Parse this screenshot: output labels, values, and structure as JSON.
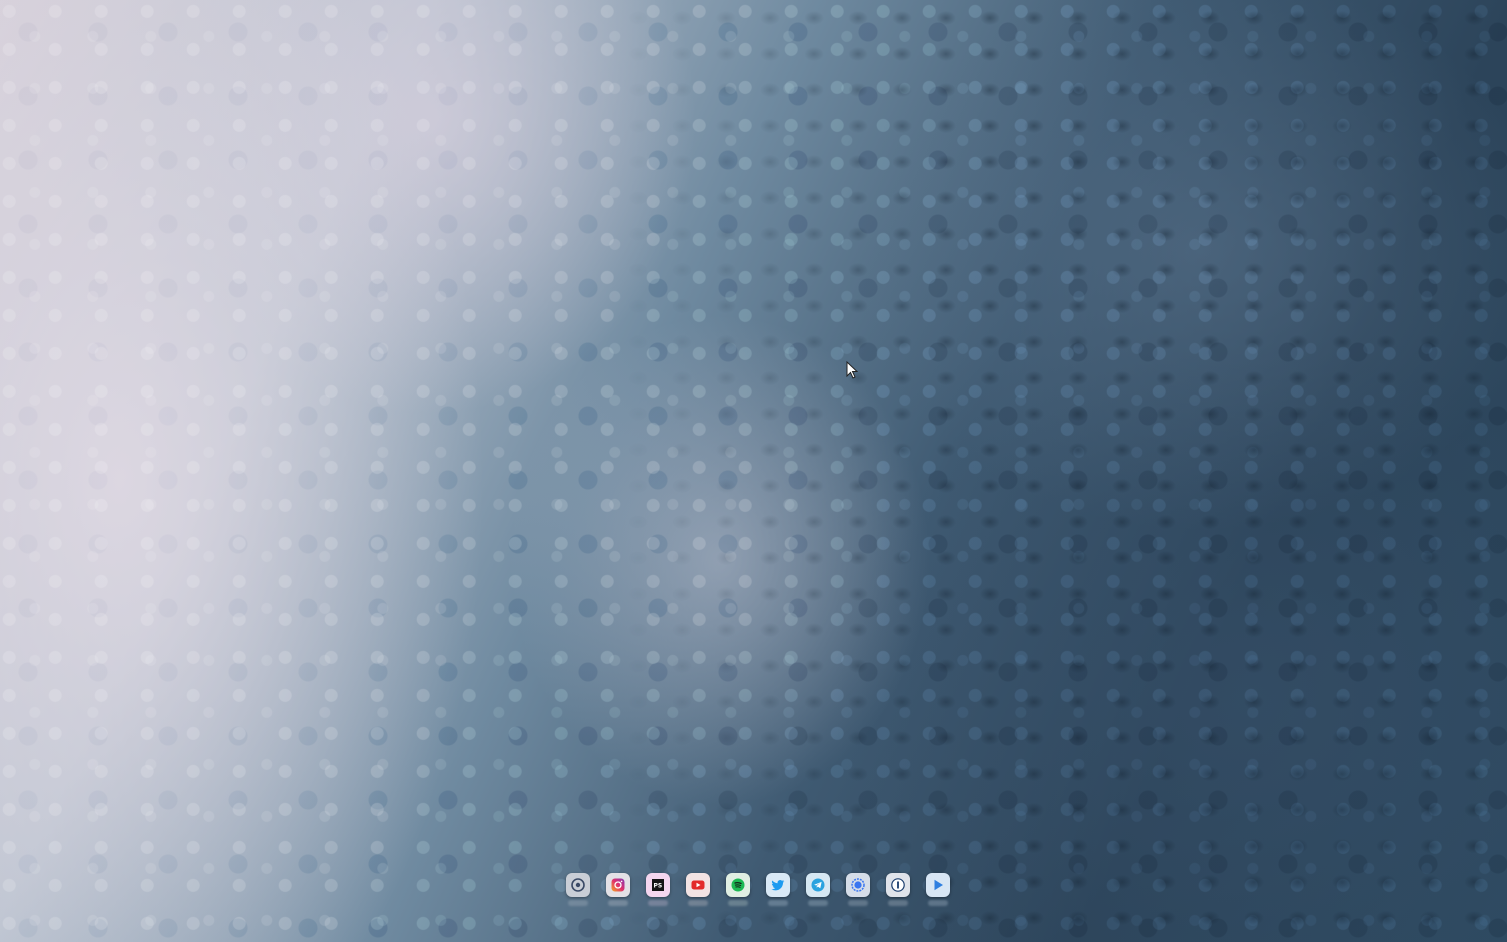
{
  "desktop": {
    "wallpaper": "ocean-waves-aerial"
  },
  "dock": {
    "items": [
      {
        "name": "chromium-icon",
        "color": "#c9ced6"
      },
      {
        "name": "instagram-icon",
        "color": "#e3e1e6"
      },
      {
        "name": "phpstorm-icon",
        "color": "#f4d6ef"
      },
      {
        "name": "youtube-icon",
        "color": "#f2e3e3"
      },
      {
        "name": "spotify-icon",
        "color": "#e1efe3"
      },
      {
        "name": "twitter-icon",
        "color": "#d9e9f6"
      },
      {
        "name": "telegram-icon",
        "color": "#d6e8f3"
      },
      {
        "name": "signal-icon",
        "color": "#d5dde8"
      },
      {
        "name": "1password-icon",
        "color": "#dfe3ea"
      },
      {
        "name": "play-icon",
        "color": "#d8e6f4"
      }
    ]
  }
}
